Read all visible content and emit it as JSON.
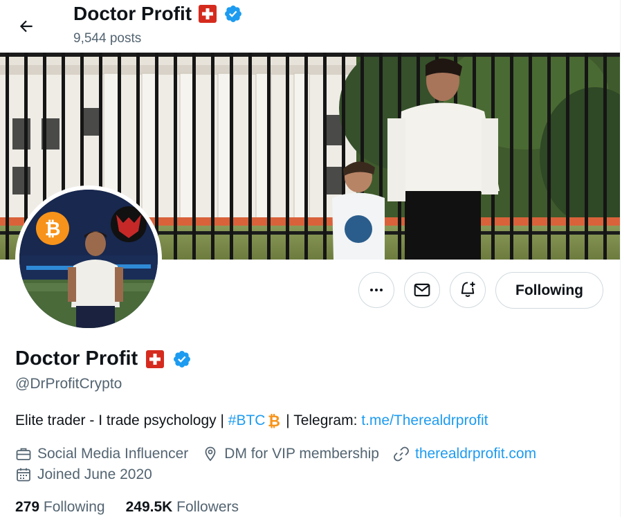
{
  "header": {
    "name": "Doctor Profit",
    "posts": "9,544 posts"
  },
  "profile": {
    "name": "Doctor Profit",
    "handle": "@DrProfitCrypto",
    "bio": {
      "text1": "Elite trader - I trade psychology | ",
      "hashtag": "#BTC",
      "text2": " | Telegram: ",
      "telegram_link": "t.me/Therealdrprofit"
    },
    "meta": {
      "category": "Social Media Influencer",
      "location": "DM for VIP membership",
      "website": "therealdrprofit.com",
      "joined": "Joined June 2020"
    },
    "counts": {
      "following_num": "279",
      "following_label": "Following",
      "followers_num": "249.5K",
      "followers_label": "Followers"
    }
  },
  "actions": {
    "follow_label": "Following"
  },
  "icons": {
    "back": "arrow-left-icon",
    "more": "more-icon",
    "message": "envelope-icon",
    "notify": "bell-plus-icon",
    "verified": "verified-badge-icon",
    "flag": "swiss-flag-icon",
    "bitcoin": "bitcoin-icon",
    "category": "briefcase-icon",
    "location": "location-pin-icon",
    "website": "link-icon",
    "joined": "calendar-icon"
  },
  "colors": {
    "accent": "#1d9bf0",
    "text": "#0f1419",
    "muted": "#536471",
    "flag_red": "#d52b1e",
    "bitcoin": "#f7931a"
  }
}
